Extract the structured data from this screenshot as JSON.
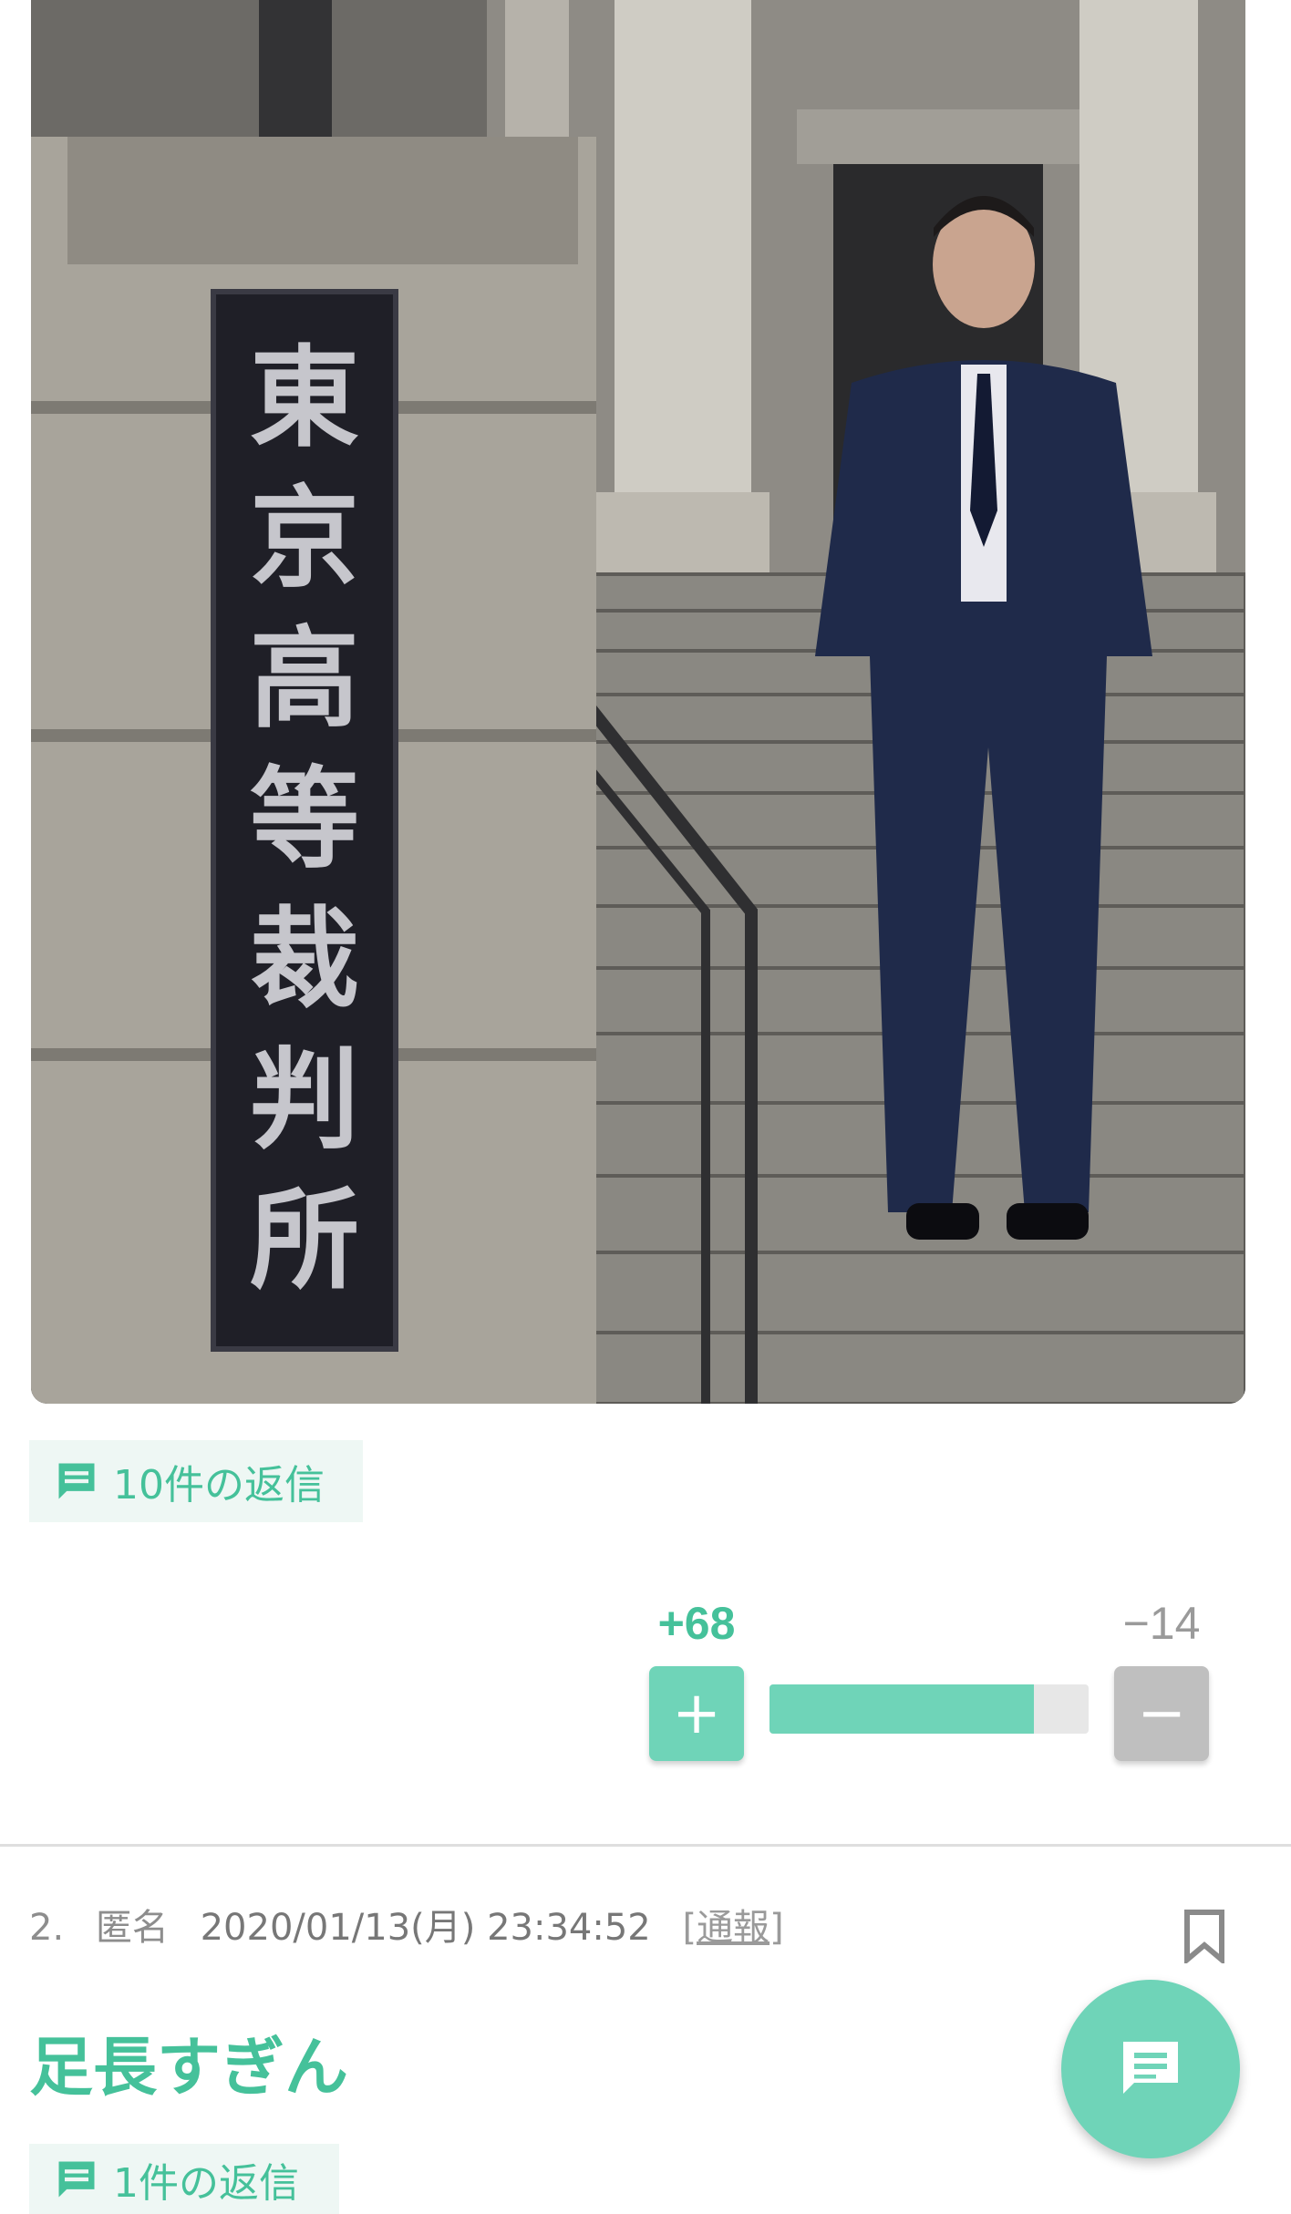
{
  "photo": {
    "sign_characters": [
      "東",
      "京",
      "高",
      "等",
      "裁",
      "判",
      "所"
    ]
  },
  "post": {
    "reply_label": "10件の返信",
    "votes": {
      "plus_count": "+68",
      "minus_count": "−14",
      "plus_symbol": "+",
      "minus_symbol": "−",
      "approval_ratio": 0.829
    }
  },
  "comment": {
    "number": "2.",
    "author": "匿名",
    "date": "2020/01/13(月) 23:34:52",
    "report_open": "[",
    "report_label": "通報",
    "report_close": "]",
    "body": "足長すぎん",
    "reply_label": "1件の返信"
  },
  "icons": {
    "reply": "comment-icon",
    "bookmark": "bookmark-icon",
    "fab": "chat-icon"
  },
  "colors": {
    "accent": "#45c19a",
    "accent_light": "#6fd4b8",
    "chip_bg": "#eef7f4",
    "minus_gray": "#bfbfbf"
  }
}
